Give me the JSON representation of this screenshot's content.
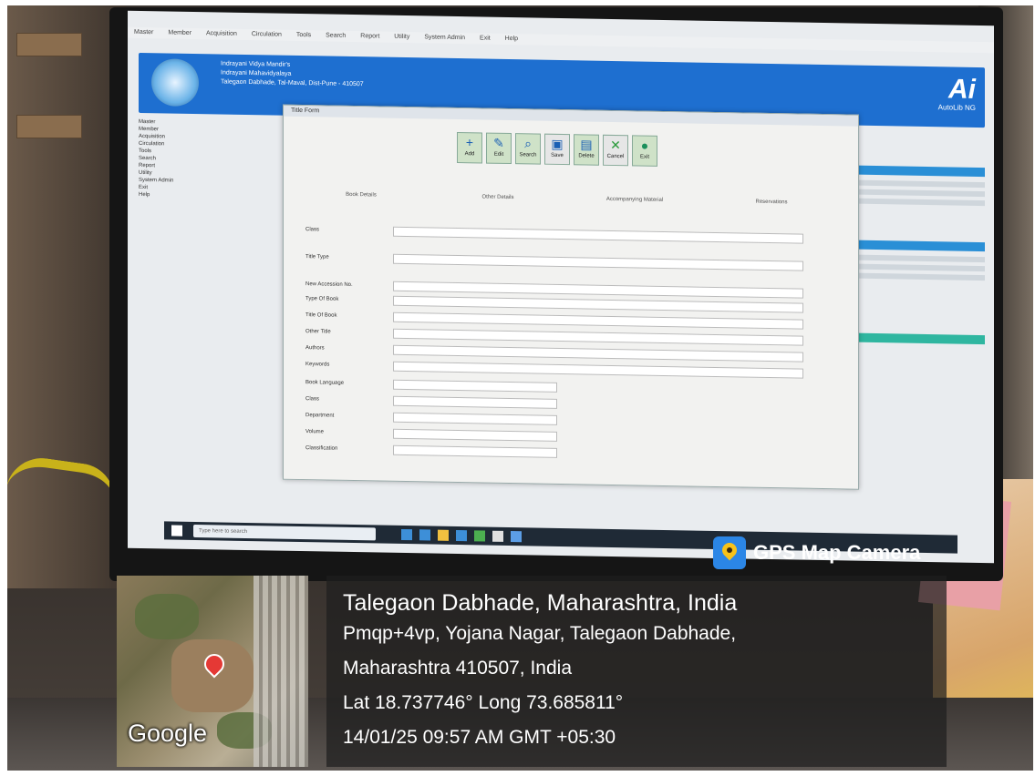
{
  "software": {
    "menu_items": [
      "Master",
      "Member",
      "Acquisition",
      "Circulation",
      "Tools",
      "Search",
      "Report",
      "Utility",
      "System Admin",
      "Exit",
      "Help"
    ],
    "banner": {
      "line1": "Indrayani Vidya Mandir's",
      "line2": "Indrayani Mahavidyalaya",
      "line3": "Talegaon Dabhade, Tal-Maval, Dist-Pune - 410507",
      "brand": "AutoLib NG"
    },
    "dialog_title": "Title Form",
    "toolbar": [
      "Add",
      "Edit",
      "Search",
      "Save",
      "Delete",
      "Cancel",
      "Exit"
    ],
    "tabs": [
      "Book Details",
      "Other Details",
      "Accompanying Material",
      "Reservations"
    ],
    "form_labels": [
      "Class",
      "Title Type",
      "New Accession No.",
      "Type Of Book",
      "Title Of Book",
      "Other Title",
      "Authors",
      "Keywords",
      "Book Language",
      "Class",
      "Department",
      "Volume",
      "Classification"
    ],
    "taskbar_search": "Type here to search"
  },
  "overlay": {
    "app_name": "GPS Map Camera",
    "map_label": "Google",
    "line1": "Talegaon Dabhade, Maharashtra, India",
    "line2": "Pmqp+4vp, Yojana Nagar, Talegaon Dabhade,",
    "line3": "Maharashtra 410507, India",
    "line4": "Lat 18.737746° Long 73.685811°",
    "line5": "14/01/25 09:57 AM GMT +05:30"
  },
  "colors": {
    "banner_blue": "#1e6fd0",
    "pin_red": "#e53935",
    "gps_icon_blue": "#2b86e6"
  }
}
